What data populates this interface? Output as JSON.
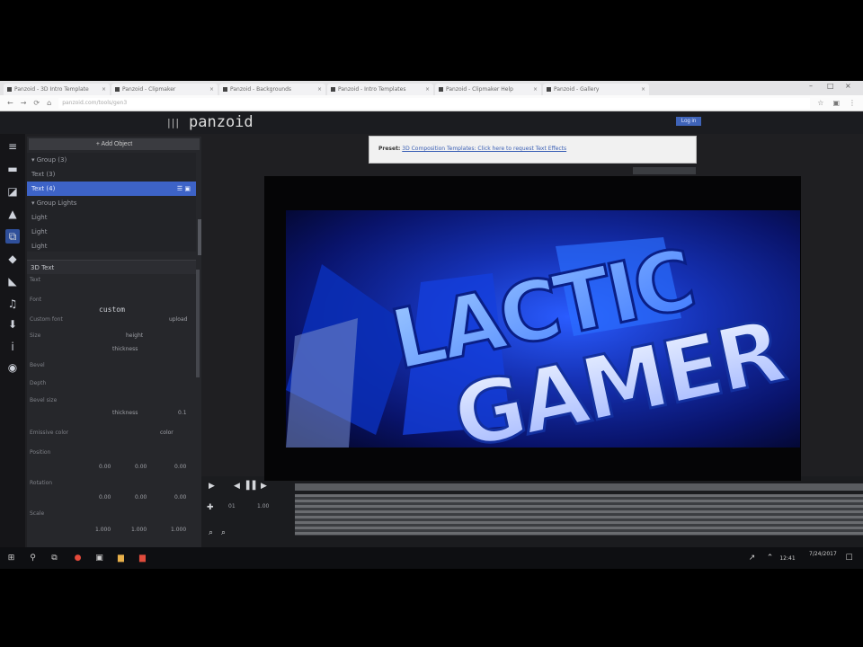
{
  "browser": {
    "tabs": [
      "Panzoid - 3D Intro Template",
      "Panzoid - Clipmaker",
      "Panzoid - Backgrounds",
      "Panzoid - Intro Templates",
      "Panzoid - Clipmaker Help",
      "Panzoid - Gallery"
    ],
    "url": "panzoid.com/tools/gen3"
  },
  "app": {
    "title": "panzoid",
    "login_label": "Log in"
  },
  "rail_icons": [
    "menu-icon",
    "folder-icon",
    "chart-icon",
    "image-icon",
    "objects-icon",
    "layers-icon",
    "media-icon",
    "music-icon",
    "download-icon",
    "info-icon",
    "globe-icon"
  ],
  "panel": {
    "add_label": "+ Add Object",
    "tree": [
      {
        "label": "▾ Group (3)"
      },
      {
        "label": "  Text (3)"
      },
      {
        "label": "  Text (4)",
        "selected": true,
        "ctrl": "☰ ▣"
      },
      {
        "label": "  ▾ Group Lights"
      },
      {
        "label": "    Light"
      },
      {
        "label": "    Light"
      },
      {
        "label": "    Light"
      }
    ],
    "section_title": "3D Text",
    "props": {
      "text_label": "Text",
      "font_label": "Font",
      "font_value": "custom",
      "custom_font_label": "Custom font",
      "custom_font_value": "upload",
      "size_label": "Size",
      "size_value_a": "height",
      "size_value_b": "thickness",
      "bevel_label": "Bevel",
      "depth_label": "Depth",
      "bevel_size_label": "Bevel size",
      "bevel_size_value": "thickness",
      "bevel_size_num": "0.1",
      "color_label": "Emissive color",
      "color_value": "color",
      "position_label": "Position",
      "position_x": "0.00",
      "position_y": "0.00",
      "position_z": "0.00",
      "rotation_label": "Rotation",
      "rotation_x": "0.00",
      "rotation_y": "0.00",
      "rotation_z": "0.00",
      "scale_label": "Scale",
      "scale_x": "1.000",
      "scale_y": "1.000",
      "scale_z": "1.000"
    }
  },
  "timeline": {
    "current": "01",
    "duration": "1.00"
  },
  "notice": {
    "label": "Preset:",
    "text": "3D Composition Templates: Click here to request Text Effects"
  },
  "canvas": {
    "line1": "LACTIC",
    "line2": "GAMER"
  },
  "taskbar": {
    "time": "12:41",
    "date": "7/24/2017"
  },
  "colors": {
    "accent": "#3d63c7",
    "background": "#1f1f22"
  }
}
